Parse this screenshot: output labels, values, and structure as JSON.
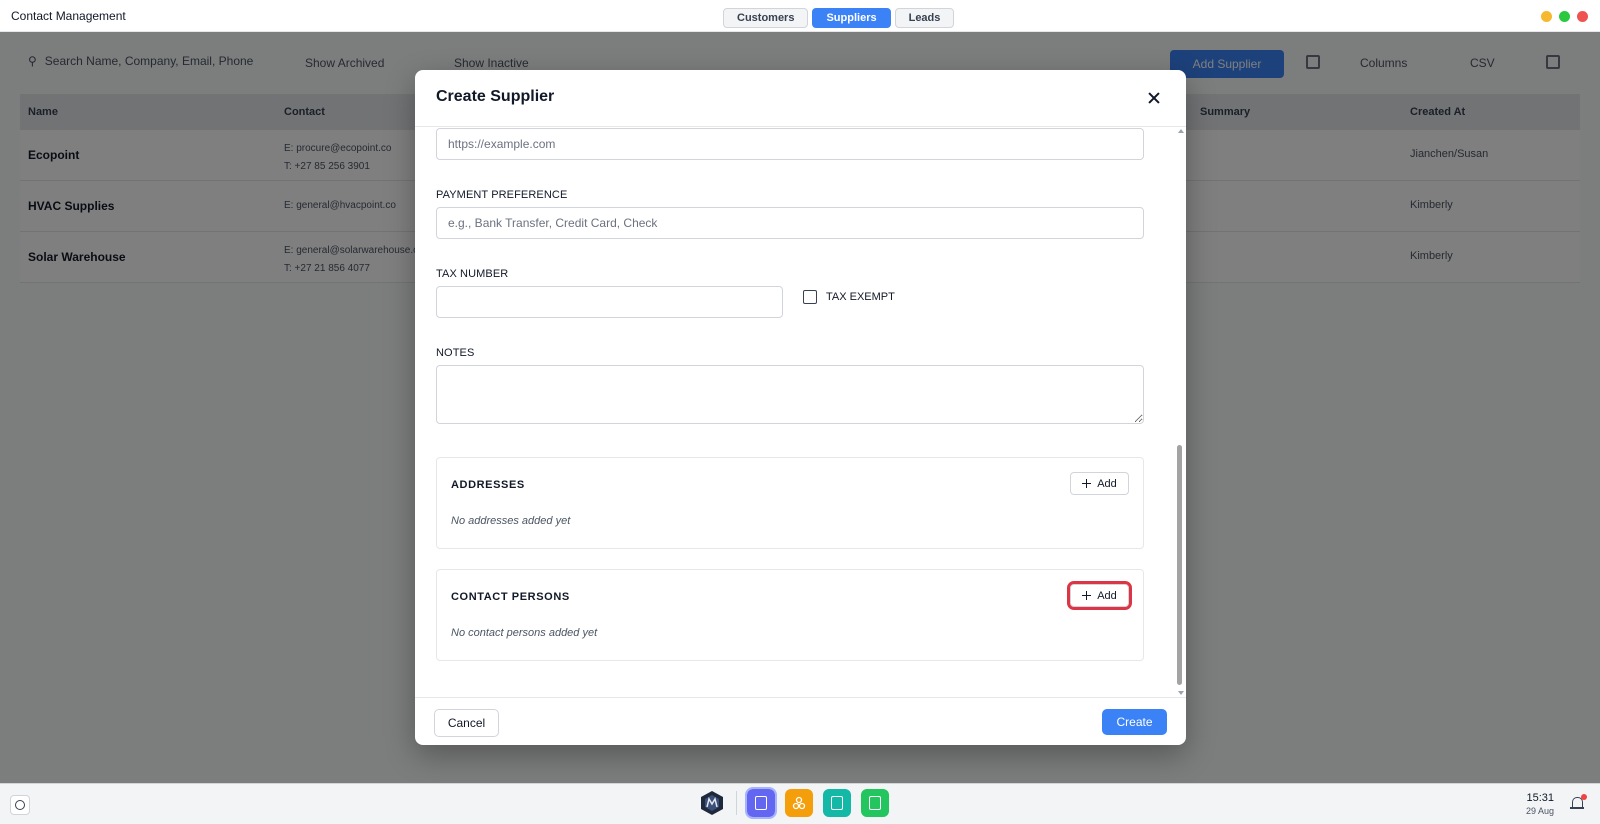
{
  "window": {
    "title": "Contact Management"
  },
  "tabs": [
    {
      "label": "Customers",
      "active": false
    },
    {
      "label": "Suppliers",
      "active": true
    },
    {
      "label": "Leads",
      "active": false
    }
  ],
  "window_controls": [
    "#f5b82e",
    "#2bc840",
    "#ef5350"
  ],
  "background": {
    "search_placeholder": "Search Name, Company, Email, Phone",
    "toolbar_items": [
      "Show Archived",
      "Show Inactive"
    ],
    "primary_button": "Add Supplier",
    "toolbar_right": [
      "Columns",
      "CSV"
    ],
    "columns": [
      "Name",
      "Contact",
      "Summary",
      "Created At"
    ],
    "rows": [
      {
        "name": "Ecopoint",
        "email": "E: procure@ecopoint.co",
        "phone": "T: +27 85 256 3901",
        "status": "Jianchen/Susan"
      },
      {
        "name": "HVAC Supplies",
        "email": "E: general@hvacpoint.co",
        "phone": "",
        "status": "Kimberly"
      },
      {
        "name": "Solar Warehouse",
        "email": "E: general@solarwarehouse.co",
        "phone": "T: +27 21 856 4077",
        "status": "Kimberly"
      }
    ]
  },
  "modal": {
    "title": "Create Supplier",
    "website_placeholder": "https://example.com",
    "payment_label": "PAYMENT PREFERENCE",
    "payment_placeholder": "e.g., Bank Transfer, Credit Card, Check",
    "tax_label": "TAX NUMBER",
    "tax_exempt_label": "TAX EXEMPT",
    "notes_label": "NOTES",
    "addresses": {
      "title": "ADDRESSES",
      "add_label": "Add",
      "empty": "No addresses added yet"
    },
    "contacts": {
      "title": "CONTACT PERSONS",
      "add_label": "Add",
      "empty": "No contact persons added yet"
    },
    "cancel_label": "Cancel",
    "create_label": "Create"
  },
  "taskbar": {
    "apps": [
      {
        "name": "contacts-app",
        "color": "#6366f1"
      },
      {
        "name": "network-app",
        "color": "#f59e0b"
      },
      {
        "name": "sheets-app",
        "color": "#14b8a6"
      },
      {
        "name": "notes-app",
        "color": "#22c55e"
      }
    ],
    "time": "15:31",
    "date": "29 Aug"
  }
}
